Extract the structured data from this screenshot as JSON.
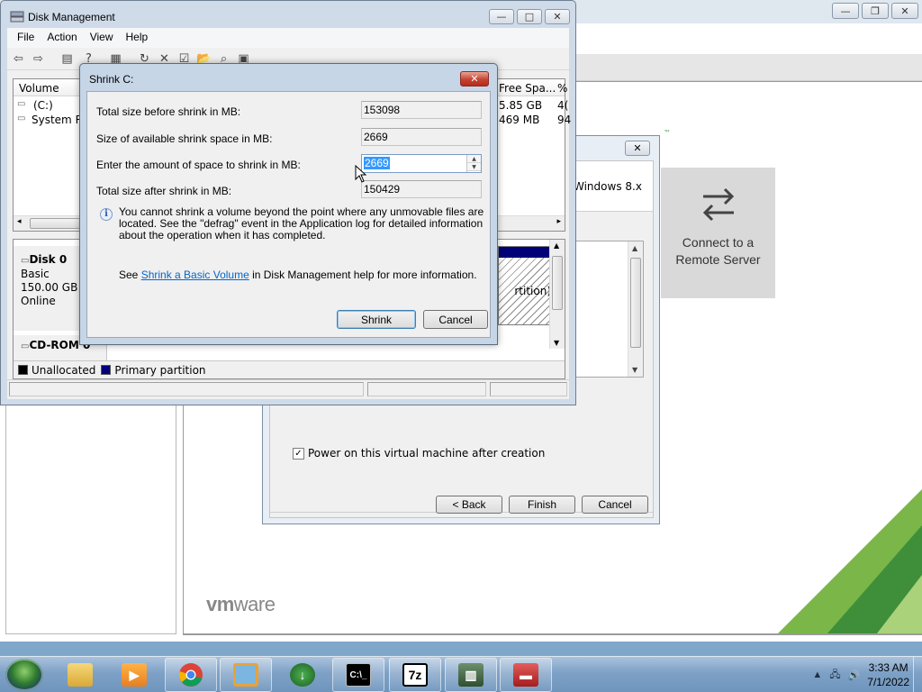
{
  "disk_management": {
    "title": "Disk Management",
    "menu": [
      "File",
      "Action",
      "View",
      "Help"
    ],
    "columns": {
      "volume": "Volume",
      "free_space": "Free Spa...",
      "pct": "%"
    },
    "volumes": [
      {
        "name": "(C:)",
        "free_space": "5.85 GB",
        "pct": "4("
      },
      {
        "name": "System Re",
        "free_space": "469 MB",
        "pct": "94"
      }
    ],
    "disk0": {
      "name": "Disk 0",
      "type": "Basic",
      "size": "150.00 GB",
      "status": "Online"
    },
    "cdrom": {
      "name": "CD-ROM 0"
    },
    "partition_label": "rtition)",
    "legend": {
      "unallocated": "Unallocated",
      "primary": "Primary partition"
    },
    "colors": {
      "unallocated": "#000000",
      "primary": "#000078"
    }
  },
  "shrink": {
    "title": "Shrink C:",
    "close": "✕",
    "labels": {
      "total_before": "Total size before shrink in MB:",
      "available": "Size of available shrink space in MB:",
      "enter_amount": "Enter the amount of space to shrink in MB:",
      "total_after": "Total size after shrink in MB:"
    },
    "values": {
      "total_before": "153098",
      "available": "2669",
      "enter_amount": "2669",
      "total_after": "150429"
    },
    "info": "You cannot shrink a volume beyond the point where any unmovable files are located. See the \"defrag\" event in the Application log for detailed information about the operation when it has completed.",
    "help_prefix": "See ",
    "help_link": "Shrink a Basic Volume",
    "help_suffix": " in Disk Management help for more information.",
    "shrink_button": "Shrink",
    "cancel_button": "Cancel"
  },
  "wizard": {
    "os_text": "Windows 8.x",
    "power_on_label": "Power on this virtual machine after creation",
    "back_button": "< Back",
    "finish_button": "Finish",
    "cancel_button": "Cancel",
    "close": "✕"
  },
  "vmware": {
    "connect_label_line1": "Connect to a",
    "connect_label_line2": "Remote Server",
    "logo_vm": "vm",
    "logo_ware": "ware",
    "trademark": "™"
  },
  "taskbar": {
    "time": "3:33 AM",
    "date": "7/1/2022",
    "apps": [
      "file-explorer",
      "media-player",
      "chrome",
      "vmware-workstation",
      "internet-download-manager",
      "command-prompt",
      "7-zip",
      "network-monitor",
      "toolbox"
    ]
  }
}
